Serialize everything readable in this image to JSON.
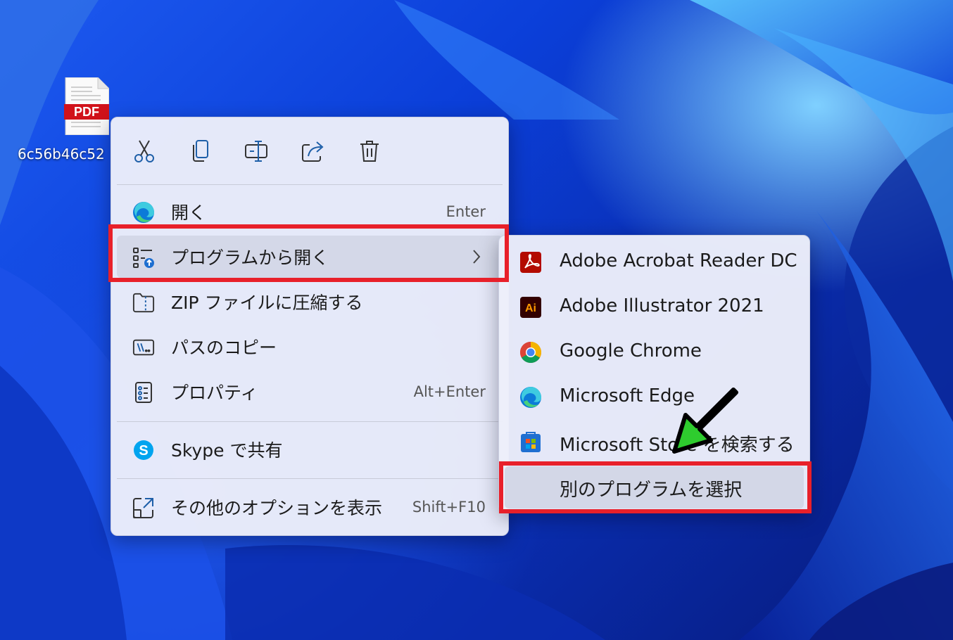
{
  "desktop": {
    "file_icon": {
      "badge": "PDF",
      "label": "6c56b46c52"
    }
  },
  "context_menu": {
    "toolbar": [
      {
        "icon": "cut-icon",
        "name": "Cut"
      },
      {
        "icon": "copy-icon",
        "name": "Copy"
      },
      {
        "icon": "rename-icon",
        "name": "Rename"
      },
      {
        "icon": "share-icon",
        "name": "Share"
      },
      {
        "icon": "delete-icon",
        "name": "Delete"
      }
    ],
    "items": [
      {
        "icon": "edge-icon",
        "label": "開く",
        "shortcut": "Enter"
      },
      {
        "icon": "open-with-icon",
        "label": "プログラムから開く",
        "shortcut": ""
      },
      {
        "icon": "zip-folder-icon",
        "label": "ZIP ファイルに圧縮する",
        "shortcut": ""
      },
      {
        "icon": "copy-path-icon",
        "label": "パスのコピー",
        "shortcut": ""
      },
      {
        "icon": "properties-icon",
        "label": "プロパティ",
        "shortcut": "Alt+Enter"
      },
      {
        "icon": "skype-icon",
        "label": "Skype で共有",
        "shortcut": ""
      },
      {
        "icon": "more-options-icon",
        "label": "その他のオプションを表示",
        "shortcut": "Shift+F10"
      }
    ]
  },
  "submenu": {
    "items": [
      {
        "icon": "acrobat-icon",
        "label": "Adobe Acrobat Reader DC"
      },
      {
        "icon": "illustrator-icon",
        "label": "Adobe Illustrator 2021",
        "icon_text": "Ai"
      },
      {
        "icon": "chrome-icon",
        "label": "Google Chrome"
      },
      {
        "icon": "edge-icon",
        "label": "Microsoft Edge"
      },
      {
        "icon": "store-icon",
        "label": "Microsoft Store を検索する"
      },
      {
        "icon": "",
        "label": "別のプログラムを選択"
      }
    ]
  },
  "colors": {
    "highlight_box": "#e8202a",
    "arrow": "#2ecc2e",
    "menu_bg": "#eceefa"
  }
}
